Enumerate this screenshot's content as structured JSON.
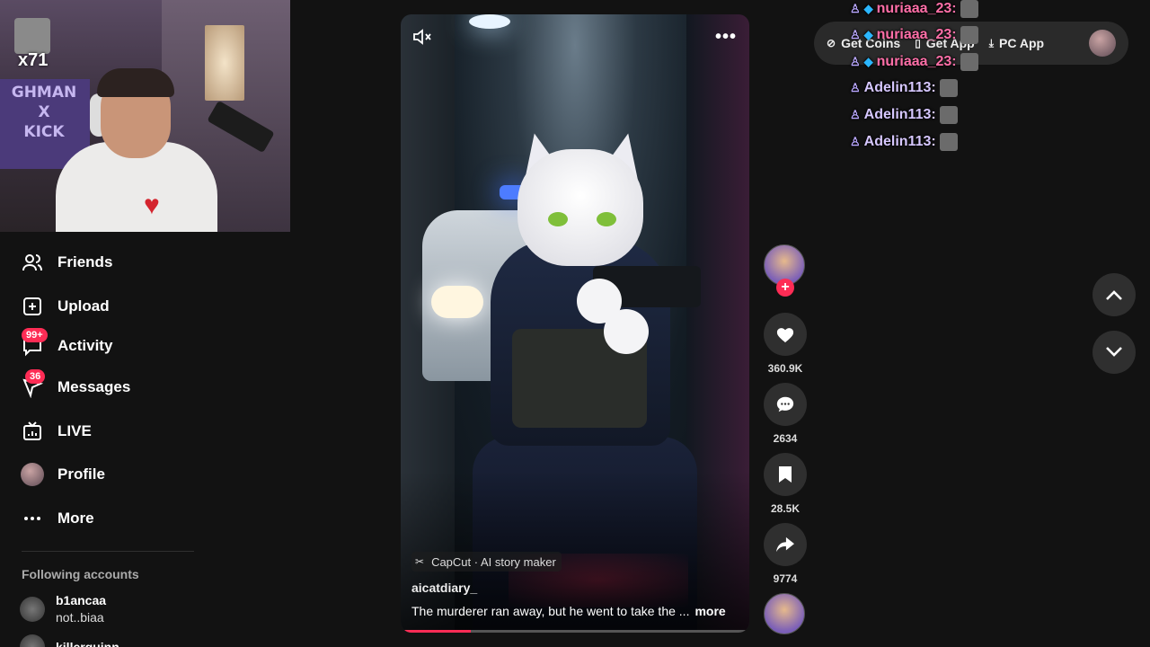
{
  "webcam": {
    "banner_text": "GHMAN\nX\nKICK",
    "badge": "x71"
  },
  "sidebar": {
    "items": [
      {
        "label": "Friends",
        "icon": "friends-icon"
      },
      {
        "label": "Upload",
        "icon": "upload-icon"
      },
      {
        "label": "Activity",
        "icon": "activity-icon",
        "badge": "99+"
      },
      {
        "label": "Messages",
        "icon": "messages-icon",
        "badge": "36"
      },
      {
        "label": "LIVE",
        "icon": "live-icon"
      },
      {
        "label": "Profile",
        "icon": "avatar"
      },
      {
        "label": "More",
        "icon": "more-icon"
      }
    ],
    "following_title": "Following accounts",
    "accounts": [
      {
        "name": "b1ancaa",
        "sub": "not..biaa"
      },
      {
        "name": "killerguinn",
        "sub": ""
      }
    ]
  },
  "video": {
    "capcut_label": "CapCut · AI story maker",
    "author": "aicatdiary_",
    "description": "The murderer ran away, but he went to take the ...",
    "more": "more",
    "progress": 0.2
  },
  "actions": {
    "likes": "360.9K",
    "comments": "2634",
    "saves": "28.5K",
    "shares": "9774"
  },
  "topbar": {
    "get_coins": "Get Coins",
    "get_app": "Get App",
    "pc_app": "PC App"
  },
  "chat": [
    {
      "user": "nuriaaa_23:",
      "style": "pink",
      "cube": true
    },
    {
      "user": "nuriaaa_23:",
      "style": "pink",
      "cube": true
    },
    {
      "user": "nuriaaa_23:",
      "style": "pink",
      "cube": true
    },
    {
      "user": "Adelin113:",
      "style": "lav",
      "cube": false
    },
    {
      "user": "Adelin113:",
      "style": "lav",
      "cube": false
    },
    {
      "user": "Adelin113:",
      "style": "lav",
      "cube": false
    }
  ],
  "colors": {
    "accent": "#fe2c55",
    "background": "#121212",
    "button_bg": "#2f2f2f"
  }
}
